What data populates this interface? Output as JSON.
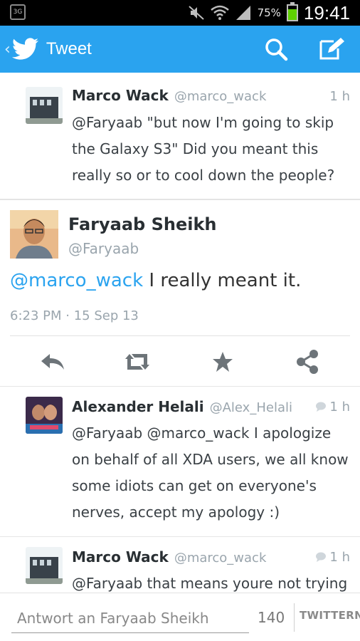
{
  "status_bar": {
    "network": "3G",
    "battery_pct": "75%",
    "battery_level": 0.75,
    "time": "19:41",
    "icons": [
      "mute-icon",
      "wifi-icon",
      "signal-icon",
      "battery-icon"
    ]
  },
  "app_bar": {
    "title": "Tweet",
    "color": "#2aa3ef",
    "actions": [
      "search-icon",
      "compose-icon"
    ]
  },
  "tweets_above": [
    {
      "name": "Marco Wack",
      "handle": "@marco_wack",
      "time": "1 h",
      "text": "@Faryaab \"but now I'm going to skip the Galaxy S3\" Did you meant this really so or to cool down the people?"
    }
  ],
  "detail": {
    "name": "Faryaab Sheikh",
    "handle": "@Faryaab",
    "mention": "@marco_wack",
    "text": " I really meant it.",
    "timestamp": "6:23 PM · 15 Sep 13",
    "actions": [
      "reply-icon",
      "retweet-icon",
      "favorite-icon",
      "share-icon"
    ]
  },
  "replies": [
    {
      "name": "Alexander Helali",
      "handle": "@Alex_Helali",
      "time": "1 h",
      "text": "@Faryaab @marco_wack I apologize on behalf of all XDA users, we all know some idiots can get on everyone's nerves, accept my apology :)"
    },
    {
      "name": "Marco Wack",
      "handle": "@marco_wack",
      "time": "1 h",
      "text": "@Faryaab that means youre not trying"
    }
  ],
  "compose": {
    "placeholder": "Antwort an Faryaab Sheikh",
    "char_count": "140",
    "send_label": "TWITTERN"
  }
}
